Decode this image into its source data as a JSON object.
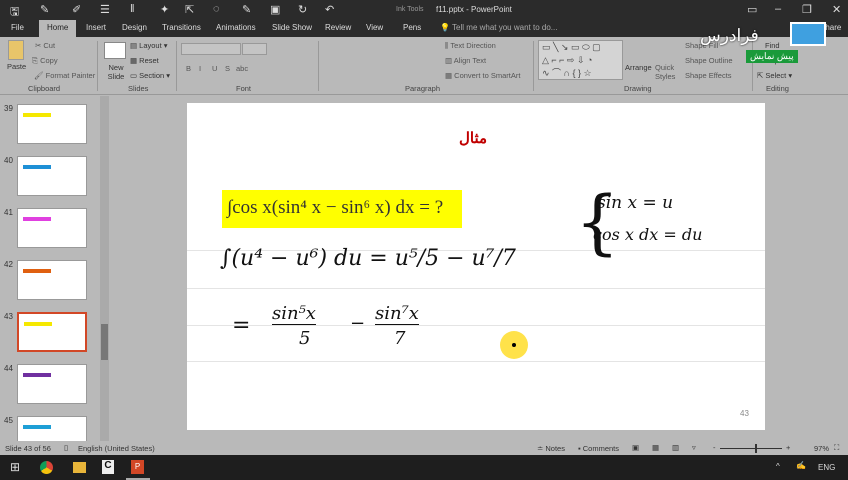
{
  "window": {
    "title": "f11.pptx - PowerPoint",
    "context_tab": "Ink Tools",
    "tell_me": "Tell me what you want to do...",
    "share": "Share"
  },
  "tabs": [
    "File",
    "Home",
    "Insert",
    "Design",
    "Transitions",
    "Animations",
    "Slide Show",
    "Review",
    "View",
    "Pens"
  ],
  "ribbon": {
    "clipboard": {
      "paste": "Paste",
      "cut": "Cut",
      "copy": "Copy",
      "format_painter": "Format Painter",
      "label": "Clipboard"
    },
    "slides": {
      "new_slide": "New Slide",
      "layout": "Layout",
      "reset": "Reset",
      "section": "Section",
      "label": "Slides"
    },
    "font": {
      "label": "Font",
      "bold": "B",
      "italic": "I",
      "underline": "U",
      "shadow": "S",
      "strike": "abc"
    },
    "paragraph": {
      "text_direction": "Text Direction",
      "align_text": "Align Text",
      "smartart": "Convert to SmartArt",
      "label": "Paragraph"
    },
    "drawing": {
      "arrange": "Arrange",
      "quick_styles": "Quick Styles",
      "shape_fill": "Shape Fill",
      "shape_outline": "Shape Outline",
      "shape_effects": "Shape Effects",
      "label": "Drawing"
    },
    "editing": {
      "find": "Find",
      "replace": "Replace",
      "select": "Select",
      "label": "Editing"
    }
  },
  "watermark": {
    "brand": "فرادرس",
    "badge": "پیش نمایش"
  },
  "thumbnails": [
    {
      "n": "39",
      "color": "#f5e800"
    },
    {
      "n": "40",
      "color": "#1e90d6"
    },
    {
      "n": "41",
      "color": "#e040e0"
    },
    {
      "n": "42",
      "color": "#e06010"
    },
    {
      "n": "43",
      "color": "#f5e800",
      "selected": true
    },
    {
      "n": "44",
      "color": "#7030a0"
    },
    {
      "n": "45",
      "color": "#1e9fd6"
    }
  ],
  "slide": {
    "title": "مثال",
    "title_color": "#c00000",
    "integral": "∫cos x(sin⁴ x − sin⁶ x) dx = ?",
    "highlight_color": "#ffff00",
    "sub1": "sin x = u",
    "sub2": "cos x dx = du",
    "line1": "∫(u⁴ − u⁶) du  =  u⁵/5 − u⁷/7",
    "line2_eq": "=",
    "line2_a_num": "sin⁵x",
    "line2_a_den": "5",
    "line2_minus": "−",
    "line2_b_num": "sin⁷x",
    "line2_b_den": "7",
    "page_number": "43"
  },
  "status": {
    "slide": "Slide 43 of 56",
    "language": "English (United States)",
    "notes": "Notes",
    "comments": "Comments",
    "zoom": "97%",
    "zoom_level": 97
  },
  "taskbar": {
    "lang": "ENG"
  }
}
